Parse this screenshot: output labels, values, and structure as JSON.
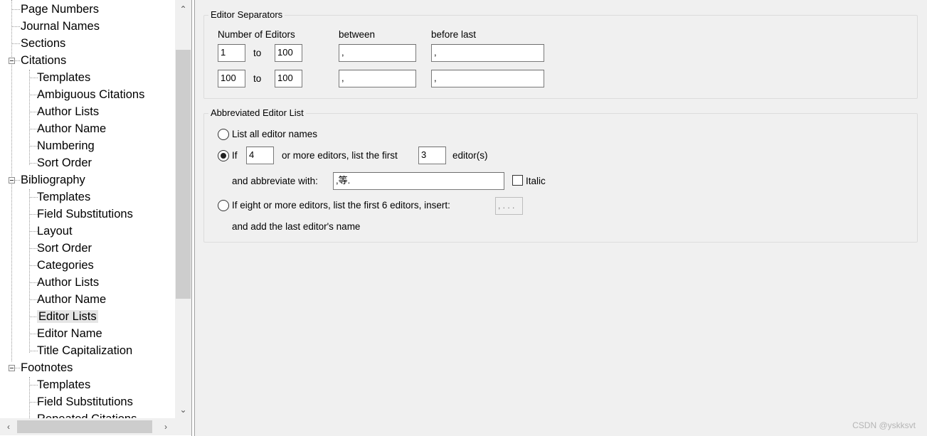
{
  "tree": {
    "items": [
      {
        "label": "Page Numbers",
        "level": 0
      },
      {
        "label": "Journal Names",
        "level": 0
      },
      {
        "label": "Sections",
        "level": 0
      },
      {
        "label": "Citations",
        "level": 0,
        "expanded": true
      },
      {
        "label": "Templates",
        "level": 1
      },
      {
        "label": "Ambiguous Citations",
        "level": 1
      },
      {
        "label": "Author Lists",
        "level": 1
      },
      {
        "label": "Author Name",
        "level": 1
      },
      {
        "label": "Numbering",
        "level": 1
      },
      {
        "label": "Sort Order",
        "level": 1
      },
      {
        "label": "Bibliography",
        "level": 0,
        "expanded": true
      },
      {
        "label": "Templates",
        "level": 1
      },
      {
        "label": "Field Substitutions",
        "level": 1
      },
      {
        "label": "Layout",
        "level": 1
      },
      {
        "label": "Sort Order",
        "level": 1
      },
      {
        "label": "Categories",
        "level": 1
      },
      {
        "label": "Author Lists",
        "level": 1
      },
      {
        "label": "Author Name",
        "level": 1
      },
      {
        "label": "Editor Lists",
        "level": 1,
        "selected": true
      },
      {
        "label": "Editor Name",
        "level": 1
      },
      {
        "label": "Title Capitalization",
        "level": 1
      },
      {
        "label": "Footnotes",
        "level": 0,
        "expanded": true
      },
      {
        "label": "Templates",
        "level": 1
      },
      {
        "label": "Field Substitutions",
        "level": 1
      },
      {
        "label": "Repeated Citations",
        "level": 1
      }
    ]
  },
  "editor_separators": {
    "legend": "Editor Separators",
    "col_number": "Number of Editors",
    "col_between": "between",
    "col_before_last": "before last",
    "to_label": "to",
    "rows": [
      {
        "from": "1",
        "to": "100",
        "between": ",",
        "before_last": ","
      },
      {
        "from": "100",
        "to": "100",
        "between": ",",
        "before_last": ","
      }
    ]
  },
  "abbreviated": {
    "legend": "Abbreviated Editor List",
    "opt1_label": "List all editor names",
    "opt2_if": "If",
    "opt2_count": "4",
    "opt2_mid": "or more editors, list the first",
    "opt2_first": "3",
    "opt2_suffix": "editor(s)",
    "abbrev_label": "and abbreviate with:",
    "abbrev_value": ",等.",
    "italic_label": "Italic",
    "opt3_label": "If eight or more editors, list the first 6 editors, insert:",
    "opt3_value": ", . . .",
    "opt3_last": "and add the last editor's name",
    "selected_option": 2
  },
  "watermark": "CSDN @yskksvt"
}
